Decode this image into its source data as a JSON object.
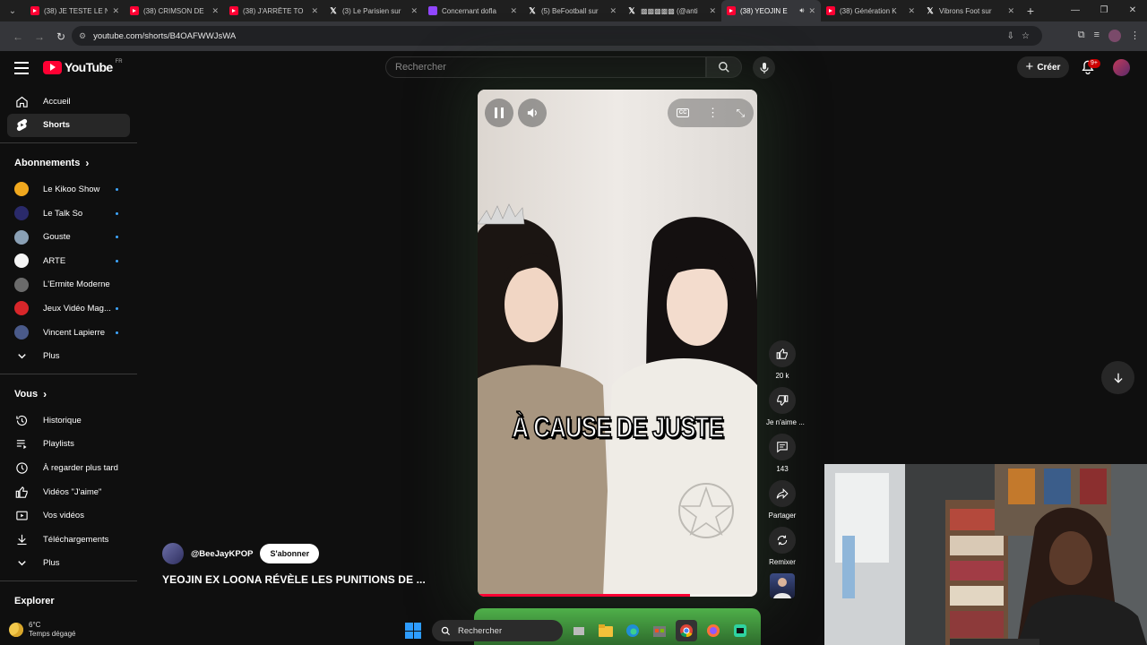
{
  "browser": {
    "tabs": [
      {
        "title": "(38) JE TESTE LE N",
        "icon": "youtube-icon",
        "active": false
      },
      {
        "title": "(38) CRIMSON DE",
        "icon": "youtube-icon",
        "active": false
      },
      {
        "title": "(38) J'ARRÊTE TO",
        "icon": "youtube-icon",
        "active": false
      },
      {
        "title": "(3) Le Parisien sur",
        "icon": "x-icon",
        "active": false
      },
      {
        "title": "Concernant dofla",
        "icon": "twitch-icon",
        "active": false
      },
      {
        "title": "(5) BeFootball sur",
        "icon": "x-icon",
        "active": false
      },
      {
        "title": "▩▩▩▩▩ (@anti",
        "icon": "x-icon",
        "active": false
      },
      {
        "title": "(38) YEOJIN E",
        "icon": "youtube-icon",
        "active": true
      },
      {
        "title": "(38) Génération K",
        "icon": "youtube-icon",
        "active": false
      },
      {
        "title": "Vibrons Foot sur",
        "icon": "x-icon",
        "active": false
      }
    ],
    "url": "youtube.com/shorts/B4OAFWWJsWA"
  },
  "header": {
    "logo_text": "YouTube",
    "region": "FR",
    "search_placeholder": "Rechercher",
    "create_label": "Créer",
    "notif_count": "9+"
  },
  "sidebar": {
    "main": [
      {
        "label": "Accueil",
        "icon": "home-icon"
      },
      {
        "label": "Shorts",
        "icon": "shorts-icon",
        "selected": true
      }
    ],
    "subscriptions_title": "Abonnements",
    "subscriptions": [
      {
        "label": "Le Kikoo Show",
        "color": "#f0a81e",
        "dot": true
      },
      {
        "label": "Le Talk So",
        "color": "#2a2a6a",
        "dot": true
      },
      {
        "label": "Gouste",
        "color": "#8aa0b5",
        "dot": true
      },
      {
        "label": "ARTE",
        "color": "#f5f5f5",
        "dot": true
      },
      {
        "label": "L'Ermite Moderne",
        "color": "#6b6b6b",
        "dot": false
      },
      {
        "label": "Jeux Vidéo Mag...",
        "color": "#d8262a",
        "dot": true
      },
      {
        "label": "Vincent Lapierre",
        "color": "#4a5a8a",
        "dot": true
      }
    ],
    "subs_more": "Plus",
    "you_title": "Vous",
    "you": [
      {
        "label": "Historique",
        "icon": "history-icon"
      },
      {
        "label": "Playlists",
        "icon": "playlist-icon"
      },
      {
        "label": "À regarder plus tard",
        "icon": "clock-icon"
      },
      {
        "label": "Vidéos \"J'aime\"",
        "icon": "like-icon"
      },
      {
        "label": "Vos vidéos",
        "icon": "video-icon"
      },
      {
        "label": "Téléchargements",
        "icon": "download-icon"
      }
    ],
    "you_more": "Plus",
    "explore_title": "Explorer"
  },
  "short": {
    "caption": "À CAUSE DE JUSTE",
    "channel": "@BeeJayKPOP",
    "subscribe_label": "S'abonner",
    "title": "YEOJIN EX LOONA RÉVÈLE LES PUNITIONS DE ...",
    "progress": 0.76,
    "actions": {
      "likes": "20 k",
      "dislike": "Je n'aime ...",
      "comments": "143",
      "share": "Partager",
      "remix": "Remixer"
    }
  },
  "taskbar": {
    "temp": "6°C",
    "weather": "Temps dégagé",
    "search_label": "Rechercher"
  }
}
